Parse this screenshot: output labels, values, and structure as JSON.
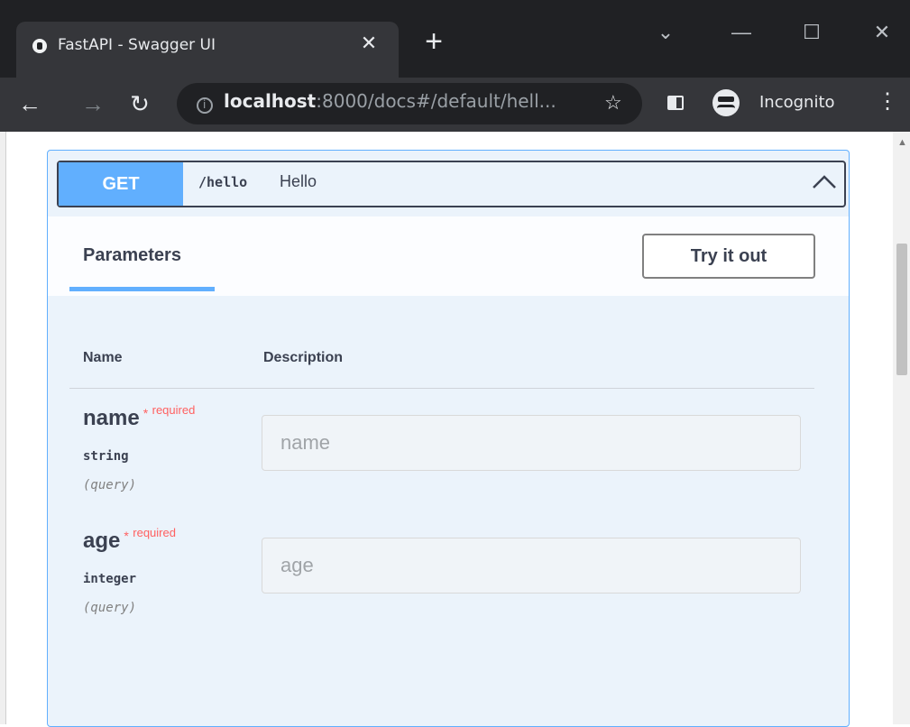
{
  "browser": {
    "tab_title": "FastAPI - Swagger UI",
    "url_host": "localhost",
    "url_rest": ":8000/docs#/default/hell...",
    "profile_label": "Incognito"
  },
  "operation": {
    "method": "GET",
    "path": "/hello",
    "summary": "Hello",
    "method_color": "#61affe"
  },
  "parameters": {
    "title": "Parameters",
    "try_label": "Try it out",
    "columns": {
      "name": "Name",
      "description": "Description"
    },
    "items": [
      {
        "name": "name",
        "required_star": "*",
        "required_text": "required",
        "type": "string",
        "in": "(query)",
        "placeholder": "name"
      },
      {
        "name": "age",
        "required_star": "*",
        "required_text": "required",
        "type": "integer",
        "in": "(query)",
        "placeholder": "age"
      }
    ]
  }
}
